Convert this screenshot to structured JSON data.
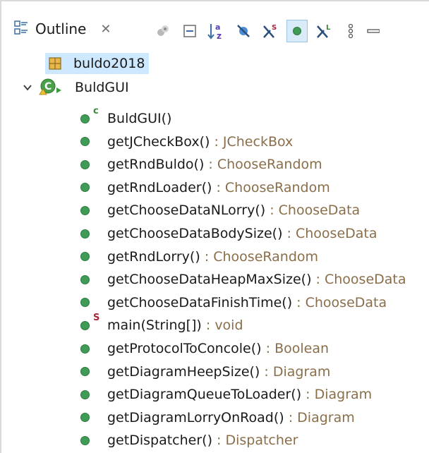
{
  "view": {
    "tab_title": "Outline",
    "close_glyph": "✕",
    "icon": "outline-view-icon"
  },
  "toolbar": [
    {
      "name": "focus-on-active-task-button",
      "icon": "focus-icon"
    },
    {
      "name": "collapse-all-button",
      "icon": "collapse-all-icon"
    },
    {
      "name": "sort-button",
      "icon": "sort-az-icon",
      "glyph": "↓"
    },
    {
      "name": "hide-fields-button",
      "icon": "hide-fields-icon"
    },
    {
      "name": "hide-static-members-button",
      "icon": "hide-static-icon",
      "glyph": "S"
    },
    {
      "name": "hide-non-public-members-button",
      "icon": "public-filter-icon",
      "active": true
    },
    {
      "name": "hide-local-types-button",
      "icon": "hide-local-types-icon",
      "glyph": "L"
    },
    {
      "name": "view-menu-button",
      "icon": "view-menu-icon"
    },
    {
      "name": "minimize-button",
      "icon": "minimize-icon"
    }
  ],
  "tree": {
    "package": {
      "label": "buldo2018",
      "icon": "package-icon",
      "selected": true
    },
    "class": {
      "label": "BuldGUI",
      "icon": "class-icon",
      "expanded": true
    },
    "members": [
      {
        "name": "BuldGUI()",
        "type": "",
        "modifier": "c"
      },
      {
        "name": "getJCheckBox()",
        "type": "JCheckBox",
        "modifier": ""
      },
      {
        "name": "getRndBuldo()",
        "type": "ChooseRandom",
        "modifier": ""
      },
      {
        "name": "getRndLoader()",
        "type": "ChooseRandom",
        "modifier": ""
      },
      {
        "name": "getChooseDataNLorry()",
        "type": "ChooseData",
        "modifier": ""
      },
      {
        "name": "getChooseDataBodySize()",
        "type": "ChooseData",
        "modifier": ""
      },
      {
        "name": "getRndLorry()",
        "type": "ChooseRandom",
        "modifier": ""
      },
      {
        "name": "getChooseDataHeapMaxSize()",
        "type": "ChooseData",
        "modifier": ""
      },
      {
        "name": "getChooseDataFinishTime()",
        "type": "ChooseData",
        "modifier": ""
      },
      {
        "name": "main(String[])",
        "type": "void",
        "modifier": "S"
      },
      {
        "name": "getProtocolToConcole()",
        "type": "Boolean",
        "modifier": ""
      },
      {
        "name": "getDiagramHeepSize()",
        "type": "Diagram",
        "modifier": ""
      },
      {
        "name": "getDiagramQueueToLoader()",
        "type": "Diagram",
        "modifier": ""
      },
      {
        "name": "getDiagramLorryOnRoad()",
        "type": "Diagram",
        "modifier": ""
      },
      {
        "name": "getDispatcher()",
        "type": "Dispatcher",
        "modifier": ""
      }
    ],
    "type_separator": " : "
  },
  "colors": {
    "method_dot": "#3f9b55",
    "type_text": "#8a6e4a",
    "selection": "#cde8ff"
  }
}
